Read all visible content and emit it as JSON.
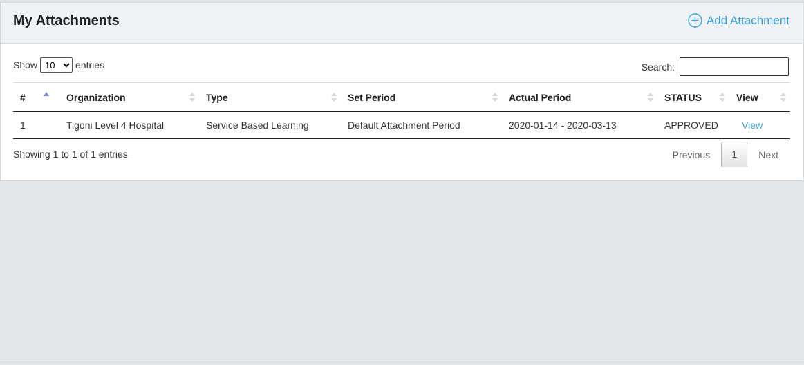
{
  "header": {
    "title": "My Attachments",
    "add_label": "Add Attachment"
  },
  "controls": {
    "show_label": "Show",
    "entries_value": "10",
    "entries_label": "entries",
    "search_label": "Search:",
    "search_value": ""
  },
  "table": {
    "columns": [
      "#",
      "Organization",
      "Type",
      "Set Period",
      "Actual Period",
      "STATUS",
      "View"
    ],
    "rows": [
      {
        "num": "1",
        "organization": "Tigoni Level 4 Hospital",
        "type": "Service Based Learning",
        "set_period": "Default Attachment Period",
        "actual_period": "2020-01-14 - 2020-03-13",
        "status": "APPROVED",
        "view": "View"
      }
    ],
    "sorted_column": "#",
    "sort_direction": "ascending"
  },
  "footer": {
    "info": "Showing 1 to 1 of 1 entries",
    "previous": "Previous",
    "current_page": "1",
    "next": "Next"
  },
  "colors": {
    "accent": "#3aa1d6",
    "header_bg": "#eef2f5",
    "page_bg": "#e4e5e7"
  },
  "icons": {
    "add": "plus-circle-icon",
    "sort": "sort-arrows-icon"
  }
}
